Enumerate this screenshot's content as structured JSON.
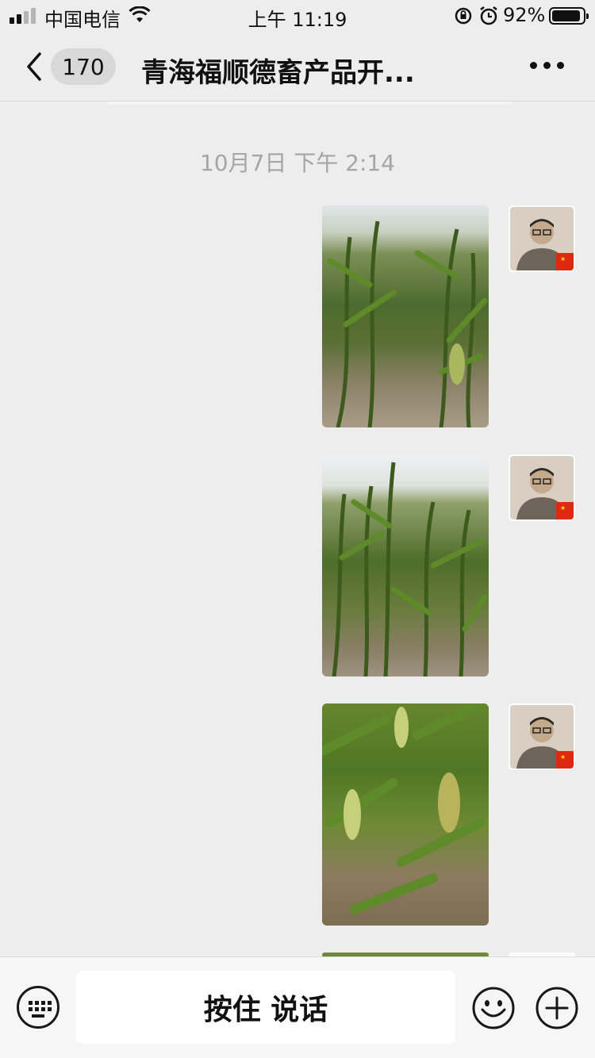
{
  "status_bar": {
    "carrier": "中国电信",
    "time": "上午 11:19",
    "battery": "92%",
    "battery_level": 0.92
  },
  "nav": {
    "unread_count": "170",
    "title": "青海福顺德畜产品开..."
  },
  "chat": {
    "timestamp": "10月7日 下午 2:14",
    "messages": [
      {
        "type": "image",
        "sender": "self",
        "content": "corn-field-photo"
      },
      {
        "type": "image",
        "sender": "self",
        "content": "corn-field-photo"
      },
      {
        "type": "image",
        "sender": "self",
        "content": "corn-field-photo"
      },
      {
        "type": "image",
        "sender": "self",
        "content": "corn-field-photo"
      }
    ]
  },
  "input_bar": {
    "hold_to_talk": "按住 说话"
  },
  "icons": {
    "back": "chevron-left-icon",
    "more": "more-icon",
    "keyboard": "keyboard-icon",
    "emoji": "emoji-icon",
    "plus": "plus-icon"
  }
}
